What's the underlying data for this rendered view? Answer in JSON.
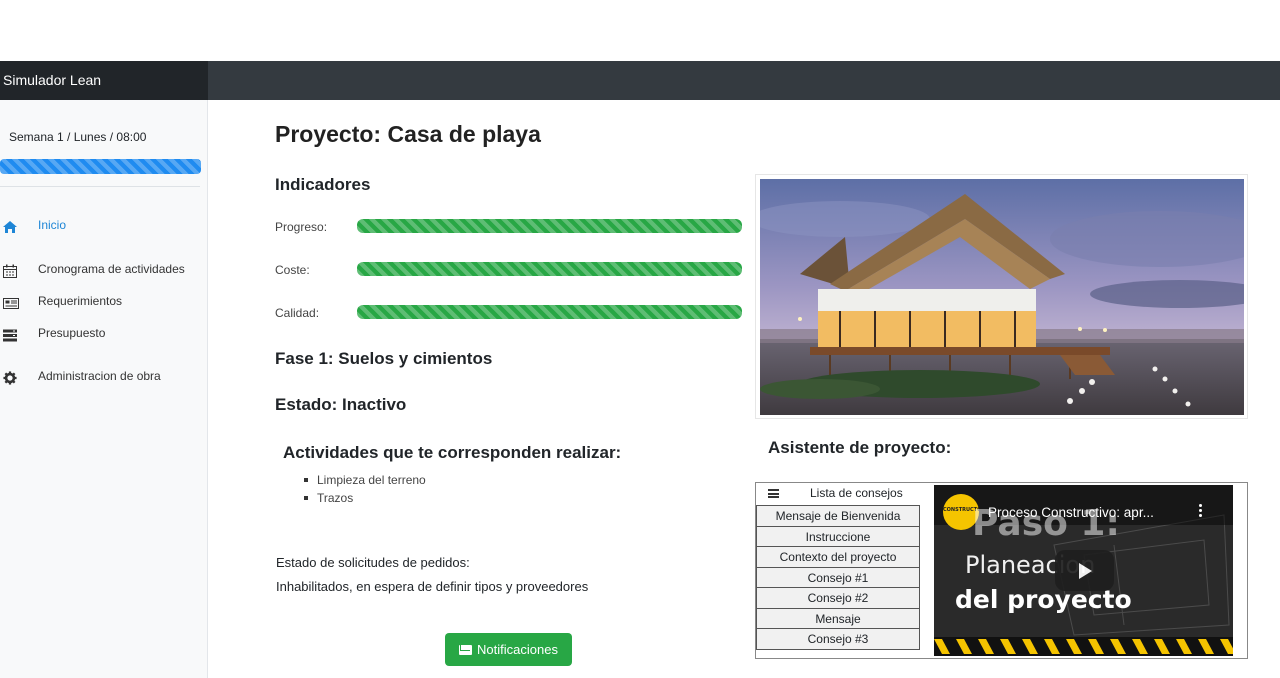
{
  "app": {
    "title": "Simulador Lean"
  },
  "sidebar": {
    "week": "Semana 1 / Lunes / 08:00",
    "items": [
      {
        "label": "Inicio",
        "icon": "home-icon",
        "active": true
      },
      {
        "label": "Cronograma de actividades",
        "icon": "calendar-icon"
      },
      {
        "label": "Requerimientos",
        "icon": "newspaper-icon"
      },
      {
        "label": "Presupuesto",
        "icon": "server-icon"
      },
      {
        "label": "Administracion de obra",
        "icon": "gear-icon"
      }
    ]
  },
  "main": {
    "title": "Proyecto: Casa de playa",
    "indicators_heading": "Indicadores",
    "indicators": [
      {
        "label": "Progreso:",
        "value": 1.0
      },
      {
        "label": "Coste:",
        "value": 1.0
      },
      {
        "label": "Calidad:",
        "value": 1.0
      }
    ],
    "fase": "Fase 1: Suelos y cimientos",
    "estado": "Estado: Inactivo",
    "activities_heading": "Actividades que te corresponden realizar:",
    "activities": [
      "Limpieza del terreno",
      "Trazos"
    ],
    "orders_label": "Estado de solicitudes de pedidos:",
    "orders_value": "Inhabilitados, en espera de definir tipos y proveedores",
    "notify_button": "Notificaciones"
  },
  "assistant": {
    "heading": "Asistente de proyecto:",
    "list_title": "Lista de consejos",
    "tips": [
      "Mensaje de Bienvenida",
      "Instruccione",
      "Contexto del proyecto",
      "Consejo #1",
      "Consejo #2",
      "Mensaje",
      "Consejo #3"
    ],
    "video": {
      "title": "Proceso Constructivo: apr...",
      "overlay_line1": "Paso 1:",
      "overlay_line2": "Planeacion",
      "overlay_line3": "del proyecto",
      "channel_badge": "CONSTRUCTOR"
    }
  },
  "colors": {
    "accent": "#1e86d6",
    "success": "#28a745",
    "navbar": "#343a40",
    "brand_bg": "#212529"
  }
}
